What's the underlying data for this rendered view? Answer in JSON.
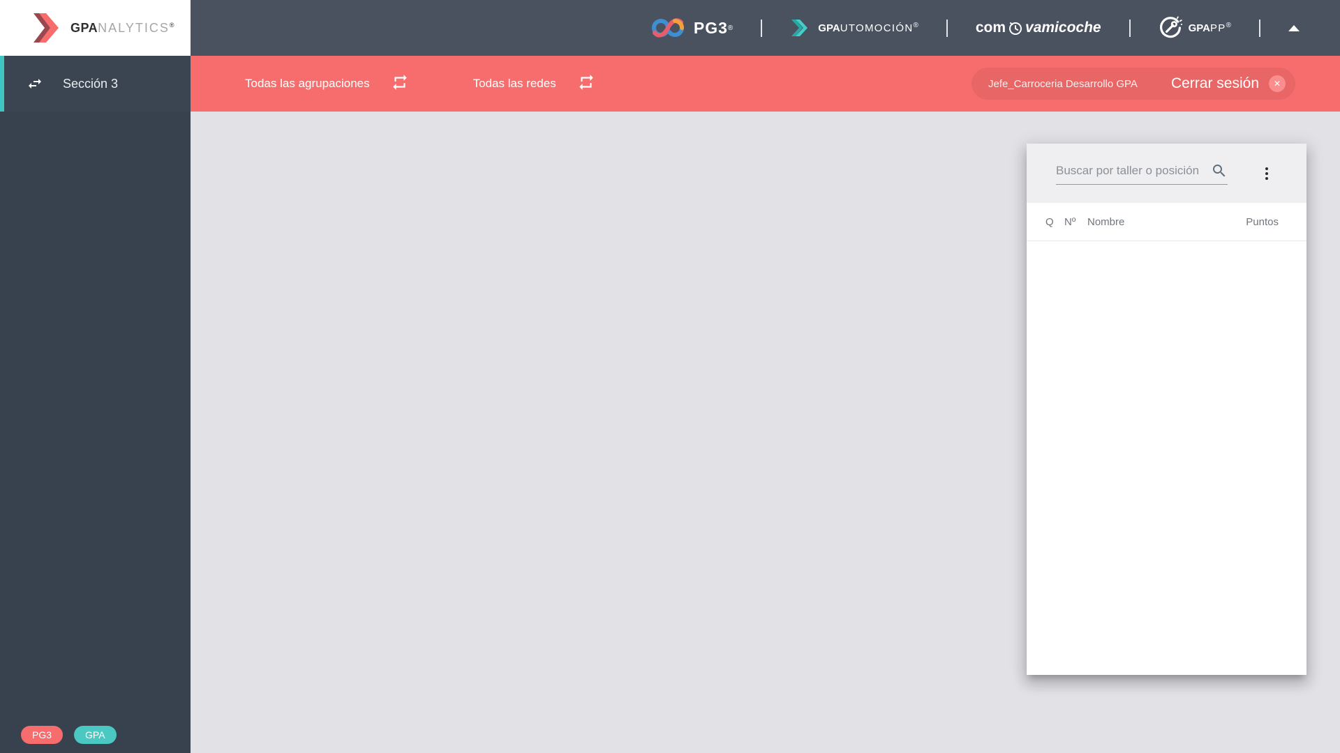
{
  "brand": {
    "gpanalytics": {
      "bold": "GPA",
      "light": "NALYTICS",
      "reg": "®"
    }
  },
  "topbar": {
    "pg3": {
      "label": "PG3",
      "reg": "®"
    },
    "gpautomocion": {
      "bold": "GPA",
      "light": "UTOMOCIÓN",
      "reg": "®"
    },
    "compravamicoche": {
      "pre": "com",
      "post": "vamicoche"
    },
    "gpapp": {
      "bold": "GPA",
      "light": "PP",
      "reg": "®"
    }
  },
  "filterbar": {
    "filters": [
      {
        "label": "Todas las agrupaciones"
      },
      {
        "label": "Todas las redes"
      }
    ],
    "user_name": "Jefe_Carroceria Desarrollo GPA",
    "logout_label": "Cerrar sesión",
    "close_icon": "✕"
  },
  "sidebar": {
    "items": [
      {
        "label": "Sección 3",
        "active": true
      }
    ],
    "badges": [
      {
        "label": "PG3",
        "color": "#F76D6D"
      },
      {
        "label": "GPA",
        "color": "#4AC8C1"
      }
    ]
  },
  "panel": {
    "search_placeholder": "Buscar por taller o posición",
    "table": {
      "headers": [
        "Q",
        "Nº",
        "Nombre",
        "Puntos"
      ],
      "rows": []
    }
  },
  "colors": {
    "topbar": "#4A5260",
    "sidebar": "#37424E",
    "accent_red": "#F76D6D",
    "accent_teal": "#40C6C2",
    "main_bg": "#E2E1E6",
    "panel_header_bg": "#EFEFF1"
  }
}
